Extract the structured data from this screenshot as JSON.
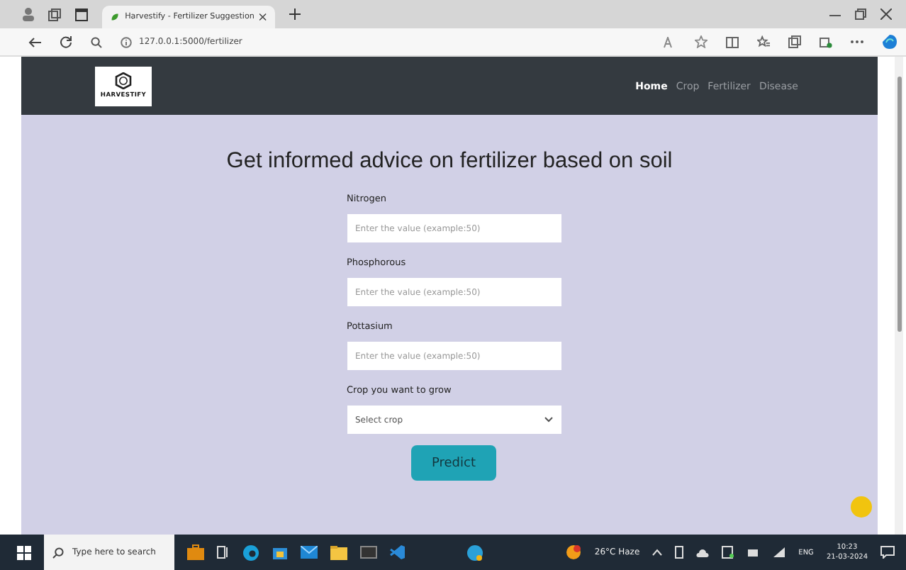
{
  "browser": {
    "tab_title": "Harvestify - Fertilizer Suggestion",
    "url": "127.0.0.1:5000/fertilizer"
  },
  "navbar": {
    "logo_text": "HARVESTIFY",
    "links": [
      {
        "label": "Home",
        "selected": true
      },
      {
        "label": "Crop",
        "selected": false
      },
      {
        "label": "Fertilizer",
        "selected": false
      },
      {
        "label": "Disease",
        "selected": false
      }
    ]
  },
  "heading": "Get informed advice on fertilizer based on soil",
  "fields": [
    {
      "label": "Nitrogen",
      "kind": "input",
      "placeholder": "Enter the value (example:50)"
    },
    {
      "label": "Phosphorous",
      "kind": "input",
      "placeholder": "Enter the value (example:50)"
    },
    {
      "label": "Pottasium",
      "kind": "input",
      "placeholder": "Enter the value (example:50)"
    },
    {
      "label": "Crop you want to grow",
      "kind": "select",
      "value": "Select crop"
    }
  ],
  "submit_button": "Predict",
  "taskbar": {
    "search_placeholder": "Type here to search",
    "weather": "26°C Haze",
    "language": "ENG",
    "time": "10:23",
    "date": "21-03-2024"
  }
}
